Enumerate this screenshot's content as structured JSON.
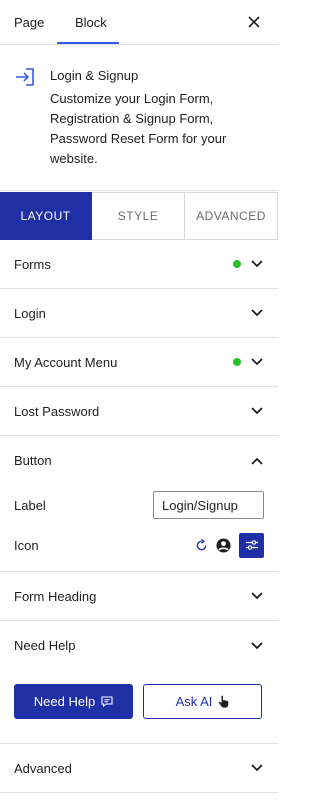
{
  "top_tabs": [
    {
      "label": "Page",
      "active": false
    },
    {
      "label": "Block",
      "active": true
    }
  ],
  "block": {
    "title": "Login & Signup",
    "description": "Customize your Login Form, Registration & Signup Form, Password Reset Form for your website."
  },
  "panel_tabs": [
    {
      "label": "LAYOUT",
      "active": true
    },
    {
      "label": "STYLE",
      "active": false
    },
    {
      "label": "ADVANCED",
      "active": false
    }
  ],
  "sections": {
    "forms": {
      "label": "Forms",
      "status_dot": true
    },
    "login": {
      "label": "Login"
    },
    "my_account_menu": {
      "label": "My Account Menu",
      "status_dot": true
    },
    "lost_password": {
      "label": "Lost Password"
    },
    "button": {
      "label": "Button",
      "expanded": true,
      "label_field": {
        "label": "Label",
        "value": "Login/Signup"
      },
      "icon_field": {
        "label": "Icon"
      }
    },
    "form_heading": {
      "label": "Form Heading"
    },
    "need_help": {
      "label": "Need Help",
      "primary_button": "Need Help",
      "secondary_button": "Ask AI"
    },
    "advanced": {
      "label": "Advanced"
    }
  },
  "colors": {
    "accent": "#1f2fa6",
    "status_dot": "#22c322",
    "tab_indicator": "#3858e9"
  },
  "icons": {
    "close": "close-icon",
    "block": "login-arrow-icon",
    "chevron_down": "chevron-down-icon",
    "chevron_up": "chevron-up-icon",
    "reset": "reset-icon",
    "user": "user-circle-icon",
    "settings": "sliders-icon",
    "chat": "chat-icon",
    "pointer": "hand-pointer-icon"
  }
}
